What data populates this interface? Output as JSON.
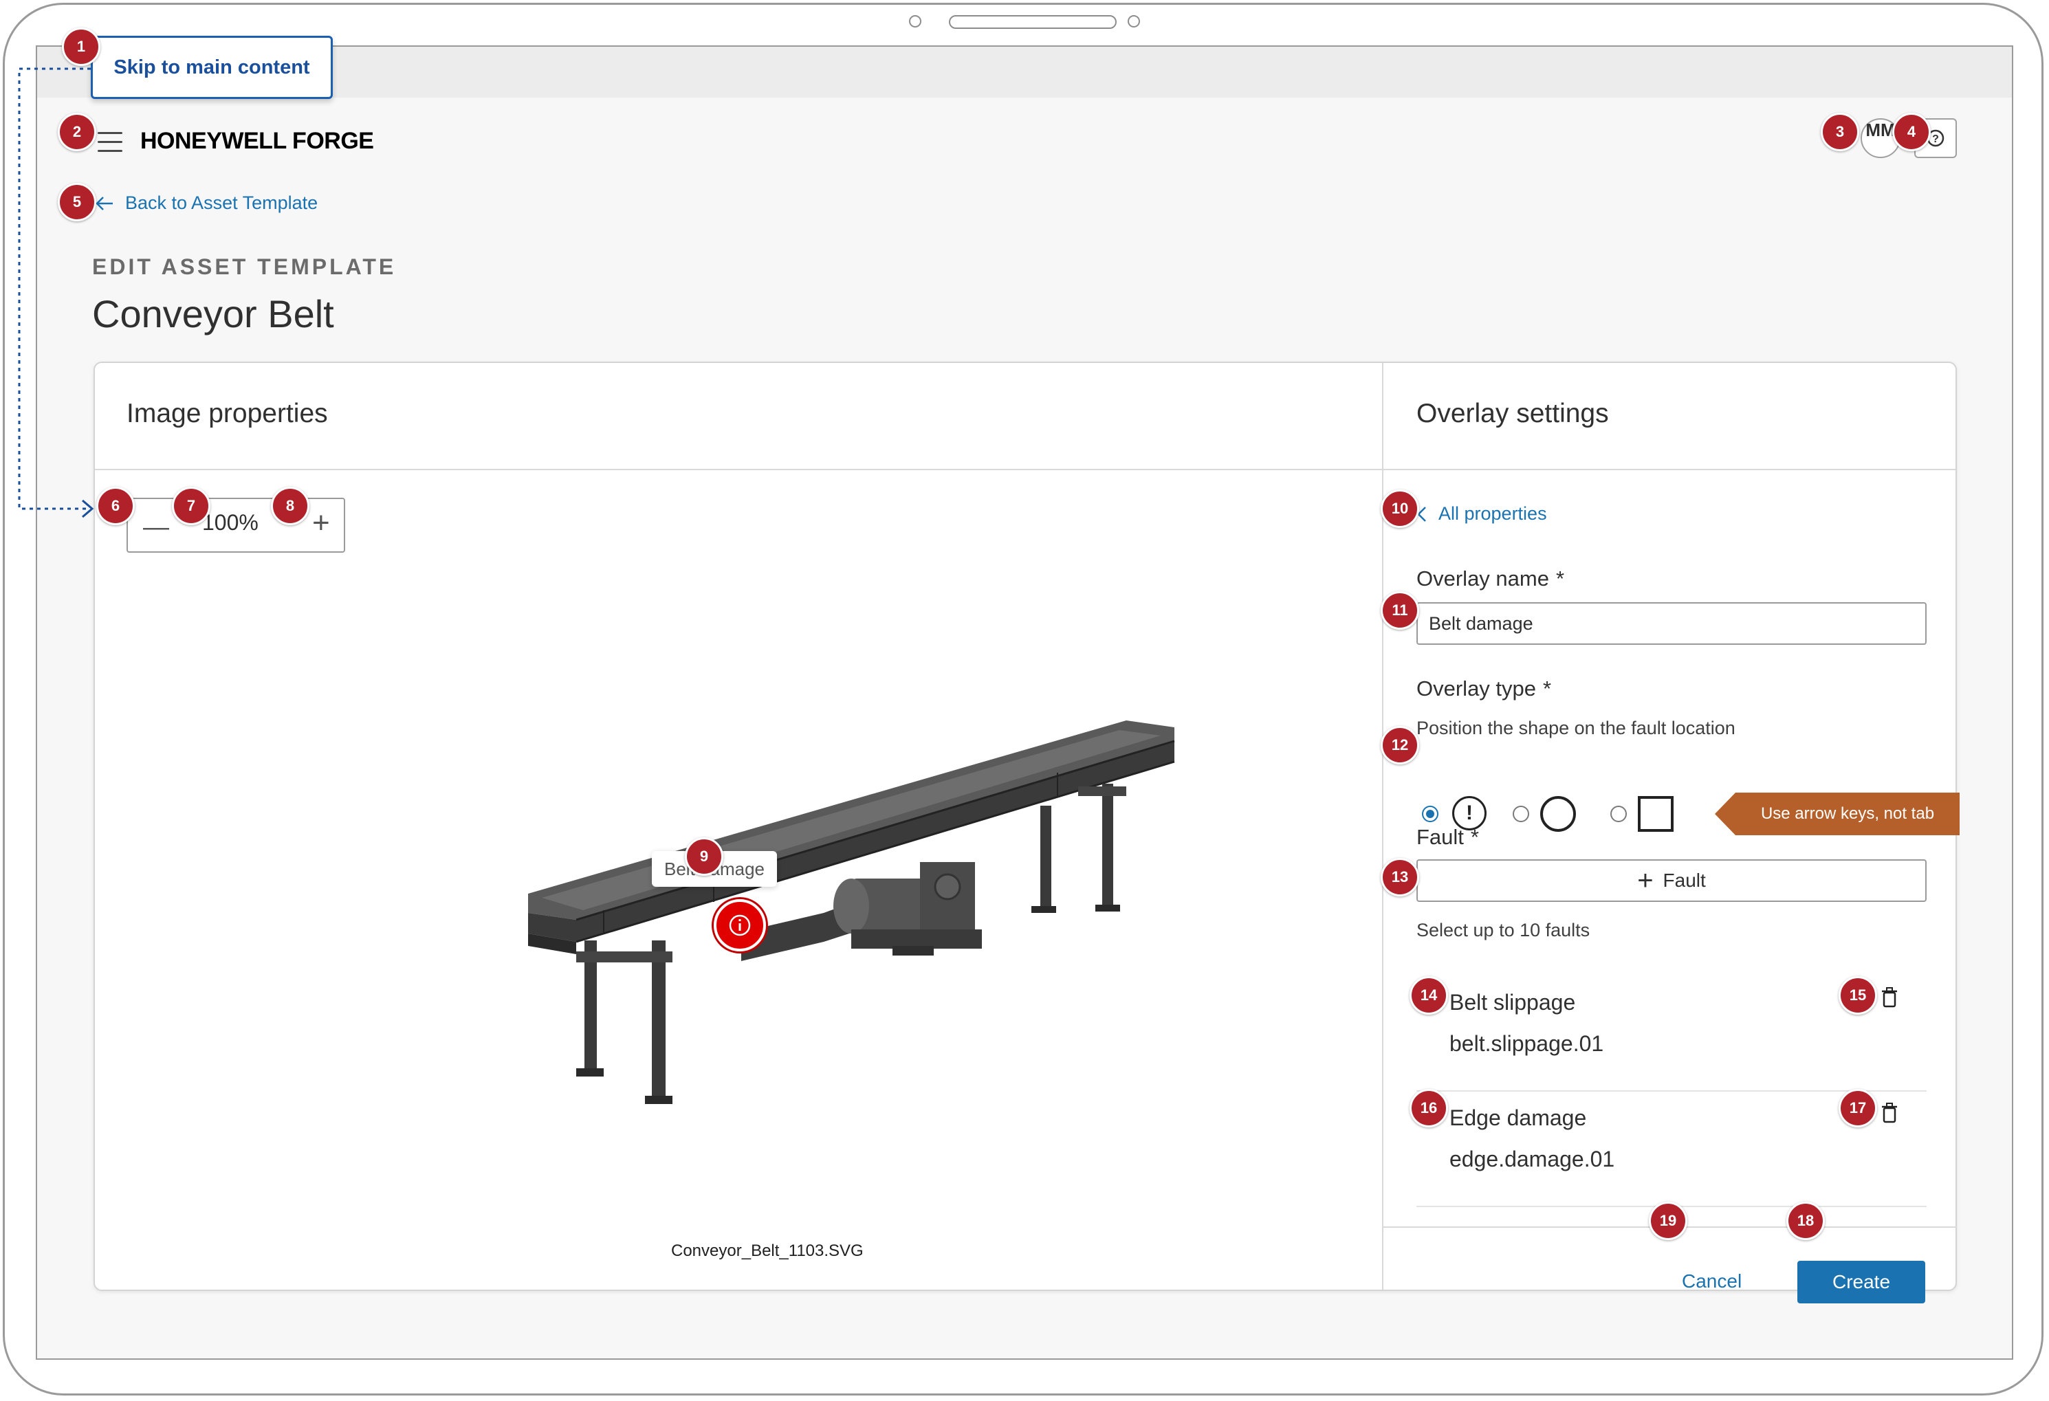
{
  "skip_link": "Skip to main content",
  "header": {
    "logo": "HONEYWELL FORGE",
    "avatar_initials": "MM"
  },
  "back_link": "Back to Asset Template",
  "page": {
    "eyebrow": "EDIT ASSET TEMPLATE",
    "title": "Conveyor Belt"
  },
  "image_panel": {
    "title": "Image properties",
    "zoom_value": "100%",
    "filename": "Conveyor_Belt_1103.SVG",
    "marker_label": "Belt damage"
  },
  "overlay_panel": {
    "title": "Overlay settings",
    "back_link": "All properties",
    "name_label": "Overlay name",
    "name_value": "Belt damage",
    "type_label": "Overlay type",
    "type_helper": "Position the shape on the fault location",
    "type_options": [
      "exclamation-circle",
      "circle",
      "square"
    ],
    "selected_type": "exclamation-circle",
    "arrow_tip": "Use arrow keys, not tab",
    "fault_label": "Fault",
    "required_mark": "*",
    "fault_button": "Fault",
    "fault_helper": "Select up to 10 faults",
    "faults": [
      {
        "name": "Belt slippage",
        "code": "belt.slippage.01"
      },
      {
        "name": "Edge damage",
        "code": "edge.damage.01"
      }
    ],
    "cancel": "Cancel",
    "create": "Create"
  },
  "badges": [
    "1",
    "2",
    "3",
    "4",
    "5",
    "6",
    "7",
    "8",
    "9",
    "10",
    "11",
    "12",
    "13",
    "14",
    "15",
    "16",
    "17",
    "18",
    "19"
  ],
  "colors": {
    "accent": "#1a73b0",
    "badge": "#b0212a",
    "marker": "#e00000",
    "tip": "#b5602a"
  }
}
